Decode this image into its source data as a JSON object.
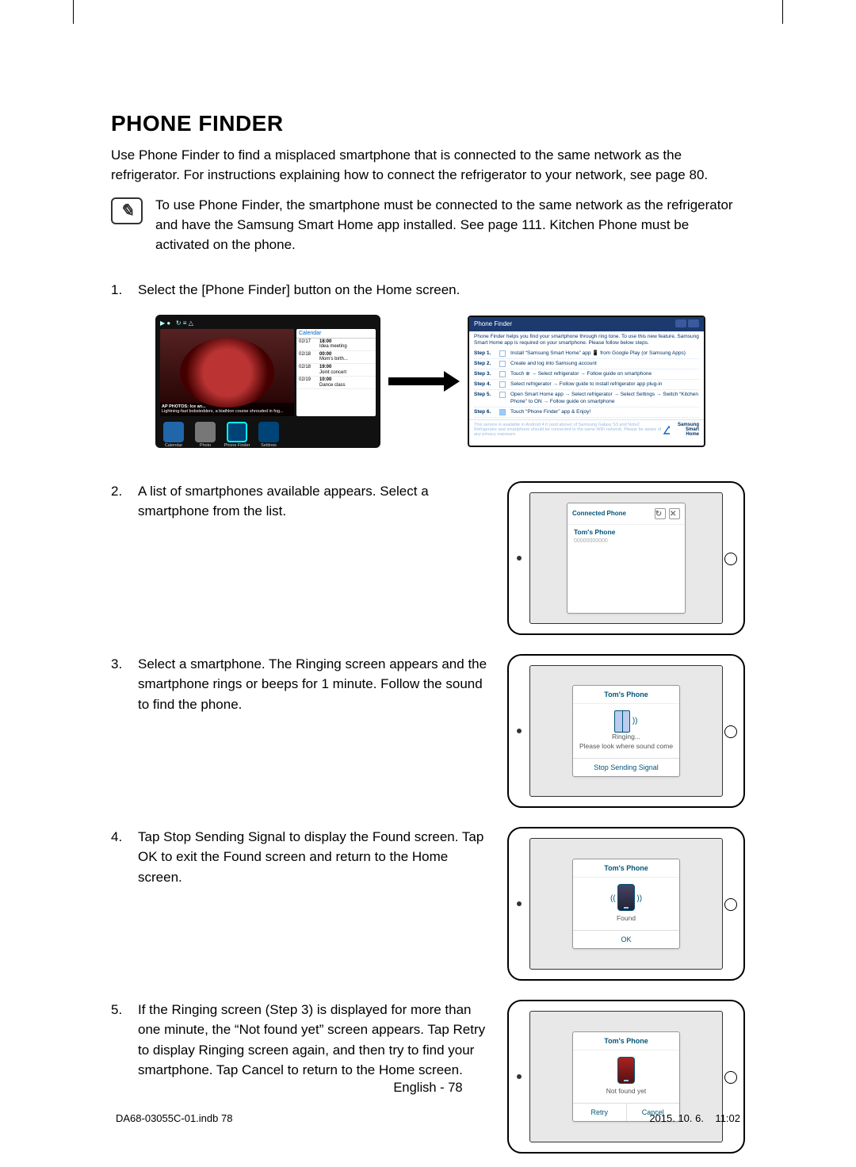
{
  "heading": "PHONE FINDER",
  "intro": "Use Phone Finder to find a misplaced smartphone that is connected to the same network as the refrigerator. For instructions explaining how to connect the refrigerator to your network, see page 80.",
  "note": "To use Phone Finder, the smartphone must be connected to the same network as the refrigerator and have the Samsung Smart Home app installed. See page 111. Kitchen Phone must be activated on the phone.",
  "steps": {
    "s1": "Select the [Phone Finder] button on the Home screen.",
    "s2": "A list of smartphones available appears. Select a smartphone from the list.",
    "s3": "Select a smartphone. The Ringing screen appears and the smartphone rings or beeps for 1 minute. Follow the sound to find the phone.",
    "s4": "Tap Stop Sending Signal to display the Found screen. Tap OK to exit the Found screen and return to the Home screen.",
    "s5": "If the Ringing screen (Step 3) is displayed for more than one minute, the “Not found yet” screen appears. Tap Retry to display Ringing screen again, and then try to find your smartphone. Tap Cancel to return to the Home screen."
  },
  "homescreen": {
    "status_icons": "▶ ●   ↻ ≡ △",
    "photo_caption_title": "AP PHOTOS: Ice an...",
    "photo_caption_sub": "Lightning-fast bobsledders, a biathlon course shrouded in fog...",
    "calendar_header": "Calendar",
    "calendar": [
      {
        "date": "02/17",
        "time": "18:00",
        "title": "Idea meeting"
      },
      {
        "date": "02/18",
        "time": "00:00",
        "title": "Mom's birth..."
      },
      {
        "date": "02/18",
        "time": "19:00",
        "title": "Joint concert"
      },
      {
        "date": "02/19",
        "time": "10:00",
        "title": "Dance class"
      }
    ],
    "dock": [
      "Calendar",
      "Photo",
      "Phone Finder",
      "Settings"
    ]
  },
  "pf_app": {
    "title": "Phone  Finder",
    "intro": "Phone Finder helps you find your smartphone through ring tone. To use this new feature, Samsung Smart Home app is required on your smartphone. Please follow below steps.",
    "steps": [
      "Install “Samsung Smart Home” app 📱 from Google Play (or Samsung Apps)",
      "Create and log into Samsung account",
      "Touch ⊕ → Select refrigerator → Follow guide on smartphone",
      "Select refrigerator → Follow guide to install refrigerator app plug-in",
      "Open Smart Home app → Select refrigerator → Select Settings → Switch “Kitchen Phone” to ON → Follow guide on smartphone",
      "Touch “Phone Finder” app & Enjoy!"
    ],
    "footnote": "This service is available in Android 4.0 (and above) of Samsung Galaxy S3 and Note2. Refrigerator and smartphone should be connected to the same WiFi network. Please be aware of any privacy exposure.",
    "brand": "Samsung Smart Home"
  },
  "devices": {
    "list": {
      "header": "Connected Phone",
      "item_title": "Tom's Phone",
      "item_sub": "00000000000",
      "refresh_icon": "↻",
      "close_icon": "✕"
    },
    "ringing": {
      "title": "Tom's Phone",
      "status": "Ringing...",
      "hint": "Please look where sound come",
      "button": "Stop Sending Signal"
    },
    "found": {
      "title": "Tom's Phone",
      "status": "Found",
      "button": "OK"
    },
    "notfound": {
      "title": "Tom's Phone",
      "status": "Not found yet",
      "retry": "Retry",
      "cancel": "Cancel"
    }
  },
  "footer_center": "English - 78",
  "print": {
    "left": "DA68-03055C-01.indb   78",
    "right": "2015. 10. 6.      11:02"
  }
}
